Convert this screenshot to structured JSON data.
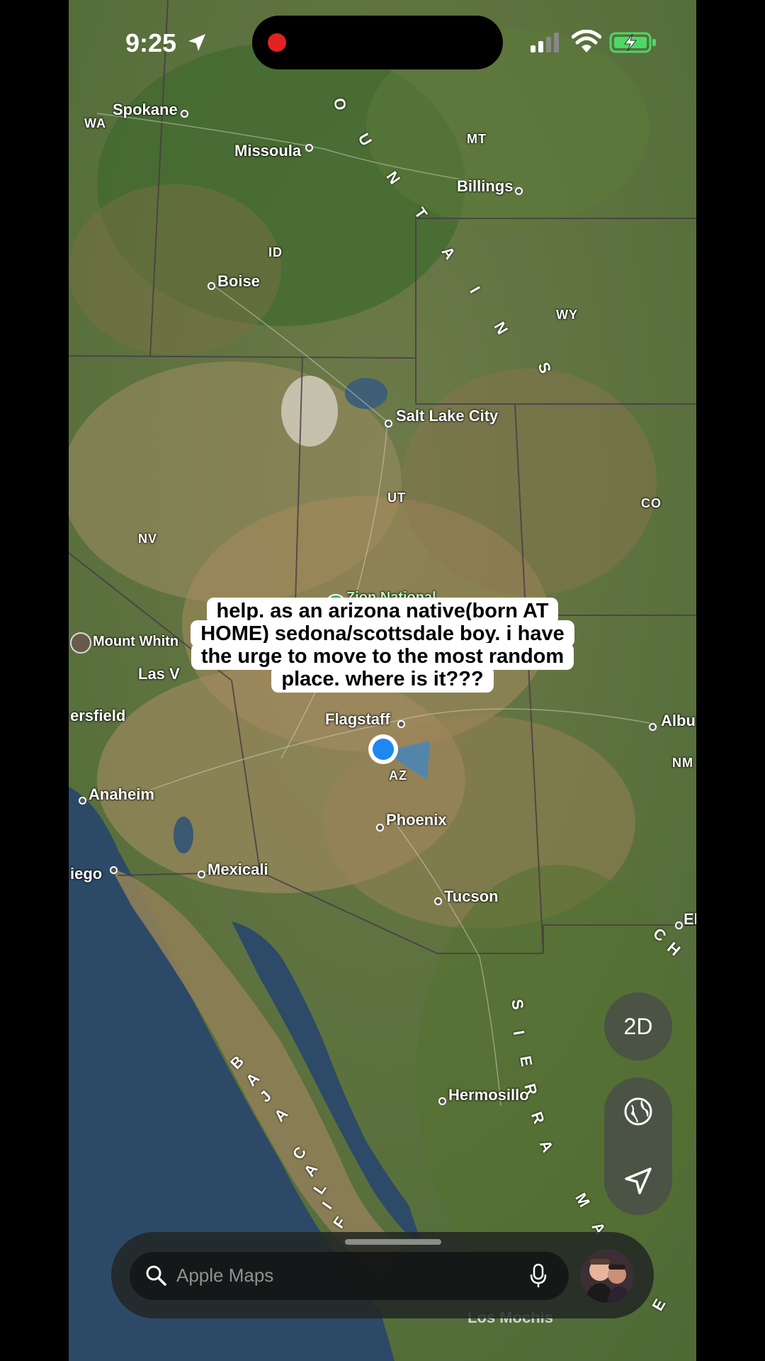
{
  "status_bar": {
    "time": "9:25"
  },
  "map": {
    "cities": {
      "spokane": "Spokane",
      "missoula": "Missoula",
      "billings": "Billings",
      "boise": "Boise",
      "salt_lake_city": "Salt Lake City",
      "zion": "Zion National",
      "mount_whitney": "Mount Whitn",
      "las_vegas": "Las V",
      "bakersfield": "ersfield",
      "flagstaff": "Flagstaff",
      "albuquerque": "Albu",
      "anaheim": "Anaheim",
      "phoenix": "Phoenix",
      "san_diego": "iego",
      "mexicali": "Mexicali",
      "tucson": "Tucson",
      "el_paso": "El",
      "hermosillo": "Hermosillo",
      "los_mochis": "Los Mochis"
    },
    "states": {
      "wa": "WA",
      "mt": "MT",
      "id": "ID",
      "wy": "WY",
      "ut": "UT",
      "co": "CO",
      "nv": "NV",
      "az": "AZ",
      "nm": "NM"
    },
    "range_labels": [
      "O",
      "U",
      "N",
      "T",
      "A",
      "I",
      "N",
      "S"
    ],
    "sierra_labels": [
      "S",
      "I",
      "E",
      "R",
      "R",
      "A",
      "M",
      "A",
      "E"
    ],
    "baja_labels": [
      "B",
      "A",
      "J",
      "A",
      "C",
      "A",
      "L",
      "I",
      "F"
    ],
    "ch_labels": [
      "C",
      "H"
    ]
  },
  "caption": {
    "line1": "help. as an arizona native(born AT",
    "line2": "HOME) sedona/scottsdale boy. i have",
    "line3": "the urge to move to the most random",
    "line4": "place. where is it???"
  },
  "controls": {
    "mode_button": "2D"
  },
  "search": {
    "placeholder": "Apple Maps"
  },
  "colors": {
    "accent": "#1e88f0",
    "record": "#e22222",
    "battery": "#4cd964"
  }
}
